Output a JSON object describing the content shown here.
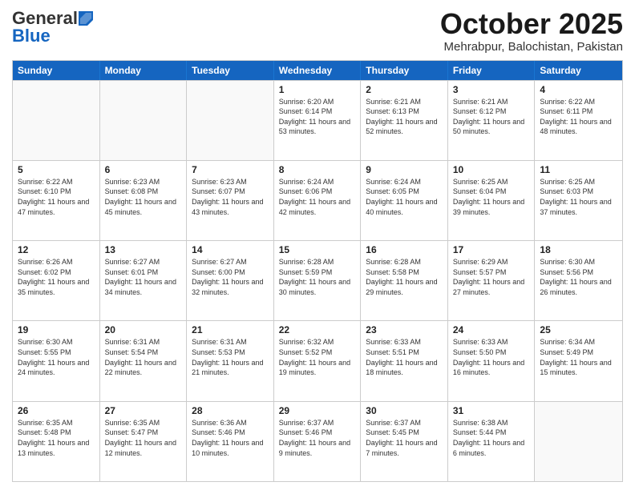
{
  "logo": {
    "general": "General",
    "blue": "Blue"
  },
  "title": "October 2025",
  "location": "Mehrabpur, Balochistan, Pakistan",
  "days_of_week": [
    "Sunday",
    "Monday",
    "Tuesday",
    "Wednesday",
    "Thursday",
    "Friday",
    "Saturday"
  ],
  "weeks": [
    [
      {
        "day": "",
        "empty": true
      },
      {
        "day": "",
        "empty": true
      },
      {
        "day": "",
        "empty": true
      },
      {
        "day": "1",
        "sunrise": "6:20 AM",
        "sunset": "6:14 PM",
        "daylight": "11 hours and 53 minutes."
      },
      {
        "day": "2",
        "sunrise": "6:21 AM",
        "sunset": "6:13 PM",
        "daylight": "11 hours and 52 minutes."
      },
      {
        "day": "3",
        "sunrise": "6:21 AM",
        "sunset": "6:12 PM",
        "daylight": "11 hours and 50 minutes."
      },
      {
        "day": "4",
        "sunrise": "6:22 AM",
        "sunset": "6:11 PM",
        "daylight": "11 hours and 48 minutes."
      }
    ],
    [
      {
        "day": "5",
        "sunrise": "6:22 AM",
        "sunset": "6:10 PM",
        "daylight": "11 hours and 47 minutes."
      },
      {
        "day": "6",
        "sunrise": "6:23 AM",
        "sunset": "6:08 PM",
        "daylight": "11 hours and 45 minutes."
      },
      {
        "day": "7",
        "sunrise": "6:23 AM",
        "sunset": "6:07 PM",
        "daylight": "11 hours and 43 minutes."
      },
      {
        "day": "8",
        "sunrise": "6:24 AM",
        "sunset": "6:06 PM",
        "daylight": "11 hours and 42 minutes."
      },
      {
        "day": "9",
        "sunrise": "6:24 AM",
        "sunset": "6:05 PM",
        "daylight": "11 hours and 40 minutes."
      },
      {
        "day": "10",
        "sunrise": "6:25 AM",
        "sunset": "6:04 PM",
        "daylight": "11 hours and 39 minutes."
      },
      {
        "day": "11",
        "sunrise": "6:25 AM",
        "sunset": "6:03 PM",
        "daylight": "11 hours and 37 minutes."
      }
    ],
    [
      {
        "day": "12",
        "sunrise": "6:26 AM",
        "sunset": "6:02 PM",
        "daylight": "11 hours and 35 minutes."
      },
      {
        "day": "13",
        "sunrise": "6:27 AM",
        "sunset": "6:01 PM",
        "daylight": "11 hours and 34 minutes."
      },
      {
        "day": "14",
        "sunrise": "6:27 AM",
        "sunset": "6:00 PM",
        "daylight": "11 hours and 32 minutes."
      },
      {
        "day": "15",
        "sunrise": "6:28 AM",
        "sunset": "5:59 PM",
        "daylight": "11 hours and 30 minutes."
      },
      {
        "day": "16",
        "sunrise": "6:28 AM",
        "sunset": "5:58 PM",
        "daylight": "11 hours and 29 minutes."
      },
      {
        "day": "17",
        "sunrise": "6:29 AM",
        "sunset": "5:57 PM",
        "daylight": "11 hours and 27 minutes."
      },
      {
        "day": "18",
        "sunrise": "6:30 AM",
        "sunset": "5:56 PM",
        "daylight": "11 hours and 26 minutes."
      }
    ],
    [
      {
        "day": "19",
        "sunrise": "6:30 AM",
        "sunset": "5:55 PM",
        "daylight": "11 hours and 24 minutes."
      },
      {
        "day": "20",
        "sunrise": "6:31 AM",
        "sunset": "5:54 PM",
        "daylight": "11 hours and 22 minutes."
      },
      {
        "day": "21",
        "sunrise": "6:31 AM",
        "sunset": "5:53 PM",
        "daylight": "11 hours and 21 minutes."
      },
      {
        "day": "22",
        "sunrise": "6:32 AM",
        "sunset": "5:52 PM",
        "daylight": "11 hours and 19 minutes."
      },
      {
        "day": "23",
        "sunrise": "6:33 AM",
        "sunset": "5:51 PM",
        "daylight": "11 hours and 18 minutes."
      },
      {
        "day": "24",
        "sunrise": "6:33 AM",
        "sunset": "5:50 PM",
        "daylight": "11 hours and 16 minutes."
      },
      {
        "day": "25",
        "sunrise": "6:34 AM",
        "sunset": "5:49 PM",
        "daylight": "11 hours and 15 minutes."
      }
    ],
    [
      {
        "day": "26",
        "sunrise": "6:35 AM",
        "sunset": "5:48 PM",
        "daylight": "11 hours and 13 minutes."
      },
      {
        "day": "27",
        "sunrise": "6:35 AM",
        "sunset": "5:47 PM",
        "daylight": "11 hours and 12 minutes."
      },
      {
        "day": "28",
        "sunrise": "6:36 AM",
        "sunset": "5:46 PM",
        "daylight": "11 hours and 10 minutes."
      },
      {
        "day": "29",
        "sunrise": "6:37 AM",
        "sunset": "5:46 PM",
        "daylight": "11 hours and 9 minutes."
      },
      {
        "day": "30",
        "sunrise": "6:37 AM",
        "sunset": "5:45 PM",
        "daylight": "11 hours and 7 minutes."
      },
      {
        "day": "31",
        "sunrise": "6:38 AM",
        "sunset": "5:44 PM",
        "daylight": "11 hours and 6 minutes."
      },
      {
        "day": "",
        "empty": true
      }
    ]
  ]
}
